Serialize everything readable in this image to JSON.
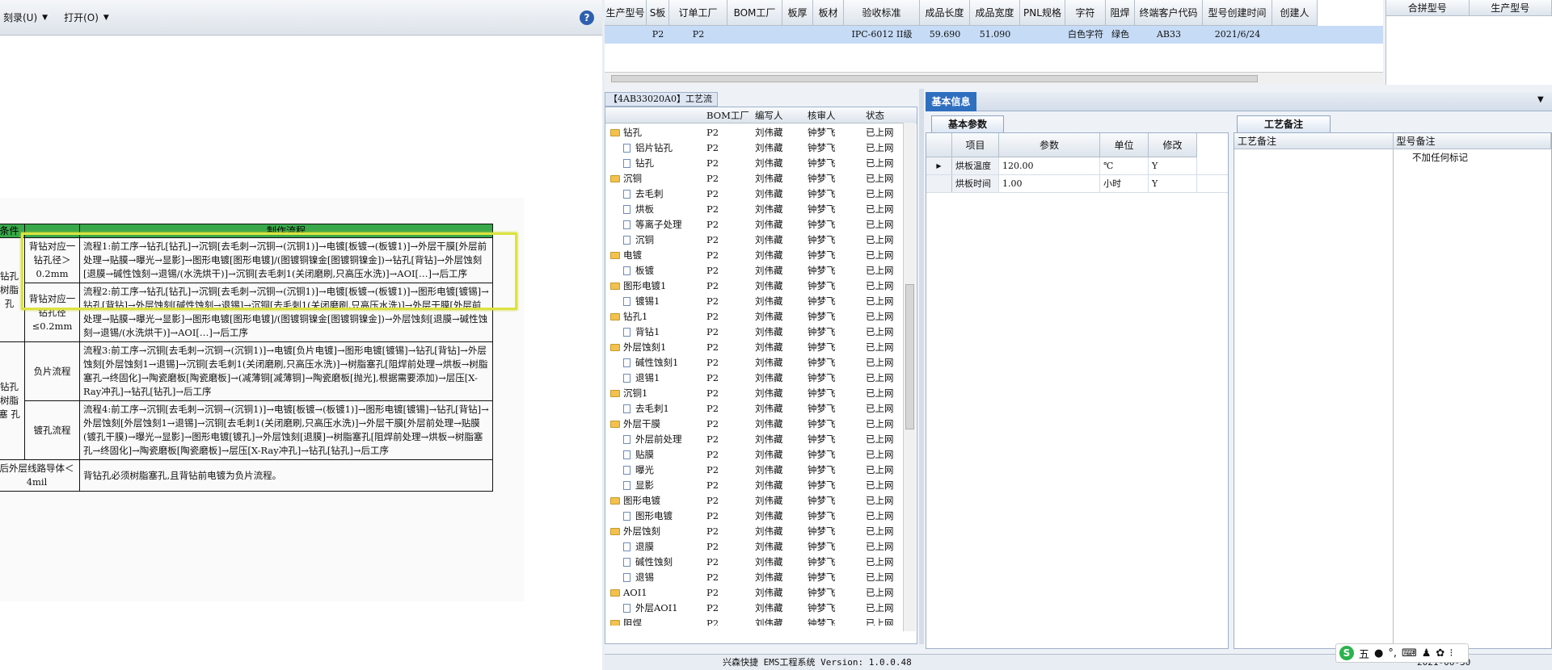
{
  "doc_viewer": {
    "menus": [
      {
        "label": "刻录(U)"
      },
      {
        "label": "打开(O)"
      }
    ],
    "help": "?",
    "table": {
      "headers": [
        "条件",
        "",
        "制作流程"
      ],
      "rows": [
        {
          "group": "钻孔 树脂 孔",
          "cond": "背钻对应一钻孔径＞0.2mm",
          "flow": "流程1:前工序→钻孔[钻孔]→沉铜[去毛刺→沉铜→(沉铜1)]→电镀[板镀→(板镀1)]→外层干膜[外层前处理→贴膜→曝光→显影]→图形电镀[图形电镀]/(图镀铜镍金[图镀铜镍金])→钻孔[背钻]→外层蚀刻[退膜→碱性蚀刻→退锡/(水洗烘干)]→沉铜[去毛刺1(关闭磨刷,只高压水洗)]→AOI[…]→后工序"
        },
        {
          "group": "",
          "cond": "背钻对应一钻孔径≤0.2mm",
          "flow": "流程2:前工序→钻孔[钻孔]→沉铜[去毛刺→沉铜→(沉铜1)]→电镀[板镀→(板镀1)]→图形电镀[镀锡]→钻孔[背钻]→外层蚀刻[碱性蚀刻→退锡]→沉铜[去毛刺1(关闭磨刷,只高压水洗)]→外层干膜[外层前处理→贴膜→曝光→显影]→图形电镀[图形电镀]/(图镀铜镍金[图镀铜镍金])→外层蚀刻[退膜→碱性蚀刻→退锡/(水洗烘干)]→AOI[…]→后工序"
        },
        {
          "group": "钻孔 树脂塞 孔",
          "cond": "负片流程",
          "flow": "流程3:前工序→沉铜[去毛刺→沉铜→(沉铜1)]→电镀[负片电镀]→图形电镀[镀锡]→钻孔[背钻]→外层蚀刻[外层蚀刻1→退锡]→沉铜[去毛刺1(关闭磨刷,只高压水洗)]→树脂塞孔[阻焊前处理→烘板→树脂塞孔→终固化]→陶瓷磨板[陶瓷磨板]→(减薄铜[减薄铜]→陶瓷磨板[抛光],根据需要添加)→层压[X-Ray冲孔]→钻孔[钻孔]→后工序"
        },
        {
          "group": "",
          "cond": "镀孔流程",
          "flow": "流程4:前工序→沉铜[去毛刺→沉铜→(沉铜1)]→电镀[板镀→(板镀1)]→图形电镀[镀锡]→钻孔[背钻]→外层蚀刻[外层蚀刻1→退锡]→沉铜[去毛刺1(关闭磨刷,只高压水洗)]→外层干膜[外层前处理→贴膜(镀孔干膜)→曝光→显影]→图形电镀[镀孔]→外层蚀刻[退膜]→树脂塞孔[阻焊前处理→烘板→树脂塞孔→终固化]→陶瓷磨板[陶瓷磨板]→层压[X-Ray冲孔]→钻孔[钻孔]→后工序"
        },
        {
          "group": "后外层线路导体＜4mil",
          "cond": "",
          "flow": "背钻孔必须树脂塞孔,且背钻前电镀为负片流程。"
        }
      ]
    }
  },
  "top_grid": {
    "columns": [
      "生产型号",
      "S板",
      "订单工厂",
      "BOM工厂",
      "板厚",
      "板材",
      "验收标准",
      "成品长度",
      "成品宽度",
      "PNL规格",
      "字符",
      "阻焊",
      "终端客户代码",
      "型号创建时间",
      "创建人"
    ],
    "row": [
      "",
      "P2",
      "P2",
      "",
      "",
      "",
      "IPC-6012 II级",
      "59.690",
      "51.090",
      "",
      "白色字符",
      "绿色",
      "AB33",
      "2021/6/24",
      ""
    ]
  },
  "right_mini": {
    "columns": [
      "合拼型号",
      "生产型号"
    ]
  },
  "process_panel": {
    "title": "【4AB33020A0】工艺流程",
    "columns": [
      "BOM工厂",
      "编写人",
      "核审人",
      "状态"
    ],
    "rows": [
      {
        "name": "钻孔",
        "type": "folder",
        "factory": "P2",
        "writer": "刘伟藏",
        "reviewer": "钟梦飞",
        "status": "已上网"
      },
      {
        "name": "铝片钻孔",
        "type": "file",
        "factory": "P2",
        "writer": "刘伟藏",
        "reviewer": "钟梦飞",
        "status": "已上网"
      },
      {
        "name": "钻孔",
        "type": "file",
        "factory": "P2",
        "writer": "刘伟藏",
        "reviewer": "钟梦飞",
        "status": "已上网"
      },
      {
        "name": "沉铜",
        "type": "folder",
        "factory": "P2",
        "writer": "刘伟藏",
        "reviewer": "钟梦飞",
        "status": "已上网"
      },
      {
        "name": "去毛刺",
        "type": "file",
        "factory": "P2",
        "writer": "刘伟藏",
        "reviewer": "钟梦飞",
        "status": "已上网"
      },
      {
        "name": "烘板",
        "type": "file",
        "factory": "P2",
        "writer": "刘伟藏",
        "reviewer": "钟梦飞",
        "status": "已上网"
      },
      {
        "name": "等离子处理",
        "type": "file",
        "factory": "P2",
        "writer": "刘伟藏",
        "reviewer": "钟梦飞",
        "status": "已上网"
      },
      {
        "name": "沉铜",
        "type": "file",
        "factory": "P2",
        "writer": "刘伟藏",
        "reviewer": "钟梦飞",
        "status": "已上网"
      },
      {
        "name": "电镀",
        "type": "folder",
        "factory": "P2",
        "writer": "刘伟藏",
        "reviewer": "钟梦飞",
        "status": "已上网"
      },
      {
        "name": "板镀",
        "type": "file",
        "factory": "P2",
        "writer": "刘伟藏",
        "reviewer": "钟梦飞",
        "status": "已上网"
      },
      {
        "name": "图形电镀1",
        "type": "folder",
        "factory": "P2",
        "writer": "刘伟藏",
        "reviewer": "钟梦飞",
        "status": "已上网"
      },
      {
        "name": "镀锡1",
        "type": "file",
        "factory": "P2",
        "writer": "刘伟藏",
        "reviewer": "钟梦飞",
        "status": "已上网"
      },
      {
        "name": "钻孔1",
        "type": "folder",
        "factory": "P2",
        "writer": "刘伟藏",
        "reviewer": "钟梦飞",
        "status": "已上网"
      },
      {
        "name": "背钻1",
        "type": "file",
        "factory": "P2",
        "writer": "刘伟藏",
        "reviewer": "钟梦飞",
        "status": "已上网"
      },
      {
        "name": "外层蚀刻1",
        "type": "folder",
        "factory": "P2",
        "writer": "刘伟藏",
        "reviewer": "钟梦飞",
        "status": "已上网"
      },
      {
        "name": "碱性蚀刻1",
        "type": "file",
        "factory": "P2",
        "writer": "刘伟藏",
        "reviewer": "钟梦飞",
        "status": "已上网"
      },
      {
        "name": "退锡1",
        "type": "file",
        "factory": "P2",
        "writer": "刘伟藏",
        "reviewer": "钟梦飞",
        "status": "已上网"
      },
      {
        "name": "沉铜1",
        "type": "folder",
        "factory": "P2",
        "writer": "刘伟藏",
        "reviewer": "钟梦飞",
        "status": "已上网"
      },
      {
        "name": "去毛刺1",
        "type": "file",
        "factory": "P2",
        "writer": "刘伟藏",
        "reviewer": "钟梦飞",
        "status": "已上网"
      },
      {
        "name": "外层干膜",
        "type": "folder",
        "factory": "P2",
        "writer": "刘伟藏",
        "reviewer": "钟梦飞",
        "status": "已上网"
      },
      {
        "name": "外层前处理",
        "type": "file",
        "factory": "P2",
        "writer": "刘伟藏",
        "reviewer": "钟梦飞",
        "status": "已上网"
      },
      {
        "name": "贴膜",
        "type": "file",
        "factory": "P2",
        "writer": "刘伟藏",
        "reviewer": "钟梦飞",
        "status": "已上网"
      },
      {
        "name": "曝光",
        "type": "file",
        "factory": "P2",
        "writer": "刘伟藏",
        "reviewer": "钟梦飞",
        "status": "已上网"
      },
      {
        "name": "显影",
        "type": "file",
        "factory": "P2",
        "writer": "刘伟藏",
        "reviewer": "钟梦飞",
        "status": "已上网"
      },
      {
        "name": "图形电镀",
        "type": "folder",
        "factory": "P2",
        "writer": "刘伟藏",
        "reviewer": "钟梦飞",
        "status": "已上网"
      },
      {
        "name": "图形电镀",
        "type": "file",
        "factory": "P2",
        "writer": "刘伟藏",
        "reviewer": "钟梦飞",
        "status": "已上网"
      },
      {
        "name": "外层蚀刻",
        "type": "folder",
        "factory": "P2",
        "writer": "刘伟藏",
        "reviewer": "钟梦飞",
        "status": "已上网"
      },
      {
        "name": "退膜",
        "type": "file",
        "factory": "P2",
        "writer": "刘伟藏",
        "reviewer": "钟梦飞",
        "status": "已上网"
      },
      {
        "name": "碱性蚀刻",
        "type": "file",
        "factory": "P2",
        "writer": "刘伟藏",
        "reviewer": "钟梦飞",
        "status": "已上网"
      },
      {
        "name": "退锡",
        "type": "file",
        "factory": "P2",
        "writer": "刘伟藏",
        "reviewer": "钟梦飞",
        "status": "已上网"
      },
      {
        "name": "AOI1",
        "type": "folder",
        "factory": "P2",
        "writer": "刘伟藏",
        "reviewer": "钟梦飞",
        "status": "已上网"
      },
      {
        "name": "外层AOI1",
        "type": "file",
        "factory": "P2",
        "writer": "刘伟藏",
        "reviewer": "钟梦飞",
        "status": "已上网"
      },
      {
        "name": "阻焊",
        "type": "folder",
        "factory": "P2",
        "writer": "刘伟藏",
        "reviewer": "钟梦飞",
        "status": "已上网"
      }
    ]
  },
  "basic_info": {
    "title": "基本信息",
    "tab": "基本参数",
    "columns": [
      "项目",
      "参数",
      "单位",
      "修改"
    ],
    "rows": [
      {
        "item": "烘板温度",
        "param": "120.00",
        "unit": "℃",
        "edit": "Y"
      },
      {
        "item": "烘板时间",
        "param": "1.00",
        "unit": "小时",
        "edit": "Y"
      }
    ]
  },
  "craft_notes": {
    "tab": "工艺备注",
    "columns": [
      "工艺备注",
      "型号备注"
    ],
    "model_note": "不加任何标记"
  },
  "status_bar": {
    "text": "兴森快捷 EMS工程系统 Version: 1.0.0.48",
    "date": "2021-06-30"
  },
  "ime": {
    "mode": "五"
  },
  "colors": {
    "selected_row": "#c6dbf6",
    "header_green": "#38a84a",
    "highlight": "#dce340",
    "panel_blue": "#2f6fc0"
  }
}
